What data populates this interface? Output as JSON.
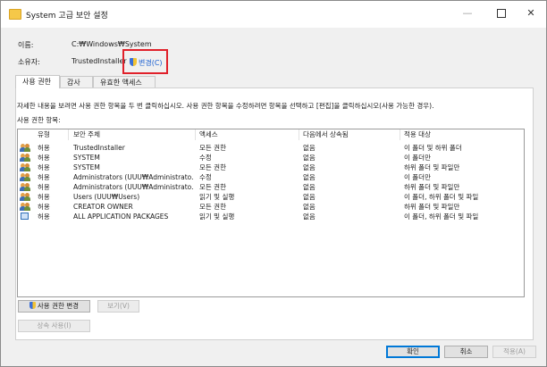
{
  "window": {
    "title": "System 고급 보안 설정",
    "min_glyph": "—",
    "close_glyph": "✕"
  },
  "info": {
    "name_label": "이름:",
    "name_value": "C:₩Windows₩System",
    "owner_label": "소유자:",
    "owner_value": "TrustedInstaller",
    "change_link": "변경(C)"
  },
  "tabs": [
    "사용 권한",
    "감사",
    "유효한 액세스"
  ],
  "description": "자세한 내용을 보려면 사용 권한 항목을 두 번 클릭하십시오. 사용 권한 항목을 수정하려면 항목을 선택하고 [편집]을 클릭하십시오(사용 가능한 경우).",
  "permission_entries_label": "사용 권한 항목:",
  "table": {
    "columns": [
      "유형",
      "보안 주체",
      "액세스",
      "다음에서 상속됨",
      "적용 대상"
    ],
    "rows": [
      {
        "icon": "users-icon",
        "type": "허용",
        "principal": "TrustedInstaller",
        "access": "모든 권한",
        "inherited": "없음",
        "applies": "이 폴더 및 하위 폴더"
      },
      {
        "icon": "users-icon",
        "type": "허용",
        "principal": "SYSTEM",
        "access": "수정",
        "inherited": "없음",
        "applies": "이 폴더만"
      },
      {
        "icon": "users-icon",
        "type": "허용",
        "principal": "SYSTEM",
        "access": "모든 권한",
        "inherited": "없음",
        "applies": "하위 폴더 및 파일만"
      },
      {
        "icon": "users-icon",
        "type": "허용",
        "principal": "Administrators (UUU₩Administrato...",
        "access": "수정",
        "inherited": "없음",
        "applies": "이 폴더만"
      },
      {
        "icon": "users-icon",
        "type": "허용",
        "principal": "Administrators (UUU₩Administrato...",
        "access": "모든 권한",
        "inherited": "없음",
        "applies": "하위 폴더 및 파일만"
      },
      {
        "icon": "users-icon",
        "type": "허용",
        "principal": "Users (UUU₩Users)",
        "access": "읽기 및 실행",
        "inherited": "없음",
        "applies": "이 폴더, 하위 폴더 및 파일"
      },
      {
        "icon": "users-icon",
        "type": "허용",
        "principal": "CREATOR OWNER",
        "access": "모든 권한",
        "inherited": "없음",
        "applies": "하위 폴더 및 파일만"
      },
      {
        "icon": "package-icon",
        "type": "허용",
        "principal": "ALL APPLICATION PACKAGES",
        "access": "읽기 및 실행",
        "inherited": "없음",
        "applies": "이 폴더, 하위 폴더 및 파일"
      }
    ]
  },
  "buttons": {
    "change_permissions": "사용 권한 변경",
    "view": "보기(V)",
    "enable_inheritance": "상속 사용(I)",
    "ok": "확인",
    "cancel": "취소",
    "apply": "적용(A)"
  }
}
